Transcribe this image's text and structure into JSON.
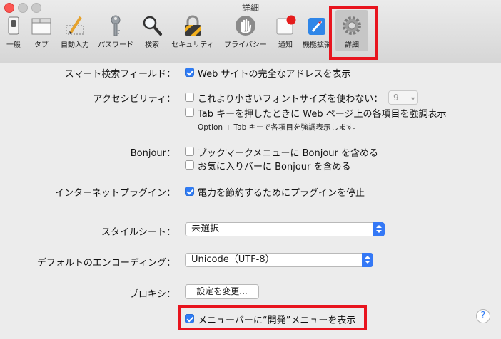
{
  "window": {
    "title": "詳細"
  },
  "toolbar": {
    "items": [
      {
        "label": "一般",
        "icon": "switch-icon"
      },
      {
        "label": "タブ",
        "icon": "tabs-icon"
      },
      {
        "label": "自動入力",
        "icon": "pencil-form-icon"
      },
      {
        "label": "パスワード",
        "icon": "key-icon"
      },
      {
        "label": "検索",
        "icon": "magnifier-icon"
      },
      {
        "label": "セキュリティ",
        "icon": "padlock-icon"
      },
      {
        "label": "プライバシー",
        "icon": "hand-icon"
      },
      {
        "label": "通知",
        "icon": "notification-icon"
      },
      {
        "label": "機能拡張",
        "icon": "extensions-icon"
      },
      {
        "label": "詳細",
        "icon": "gear-icon",
        "selected": true
      }
    ]
  },
  "settings": {
    "smart_search": {
      "label": "スマート検索フィールド：",
      "option": "Web サイトの完全なアドレスを表示",
      "checked": true
    },
    "accessibility": {
      "label": "アクセシビリティ：",
      "option1": "これより小さいフォントサイズを使わない：",
      "option1_checked": false,
      "font_size": "9",
      "option2": "Tab キーを押したときに Web ページ上の各項目を強調表示",
      "option2_checked": false,
      "note": "Option + Tab キーで各項目を強調表示します。"
    },
    "bonjour": {
      "label": "Bonjour：",
      "option1": "ブックマークメニューに Bonjour を含める",
      "option1_checked": false,
      "option2": "お気に入りバーに Bonjour を含める",
      "option2_checked": false
    },
    "plugins": {
      "label": "インターネットプラグイン：",
      "option": "電力を節約するためにプラグインを停止",
      "checked": true
    },
    "stylesheet": {
      "label": "スタイルシート：",
      "value": "未選択"
    },
    "encoding": {
      "label": "デフォルトのエンコーディング：",
      "value": "Unicode（UTF-8）"
    },
    "proxy": {
      "label": "プロキシ：",
      "button": "設定を変更..."
    },
    "develop_menu": {
      "option": "メニューバーに“開発”メニューを表示",
      "checked": true
    }
  },
  "help": {
    "label": "?"
  },
  "colors": {
    "accent": "#2f7cf6",
    "highlight_frame": "#e8141e"
  }
}
